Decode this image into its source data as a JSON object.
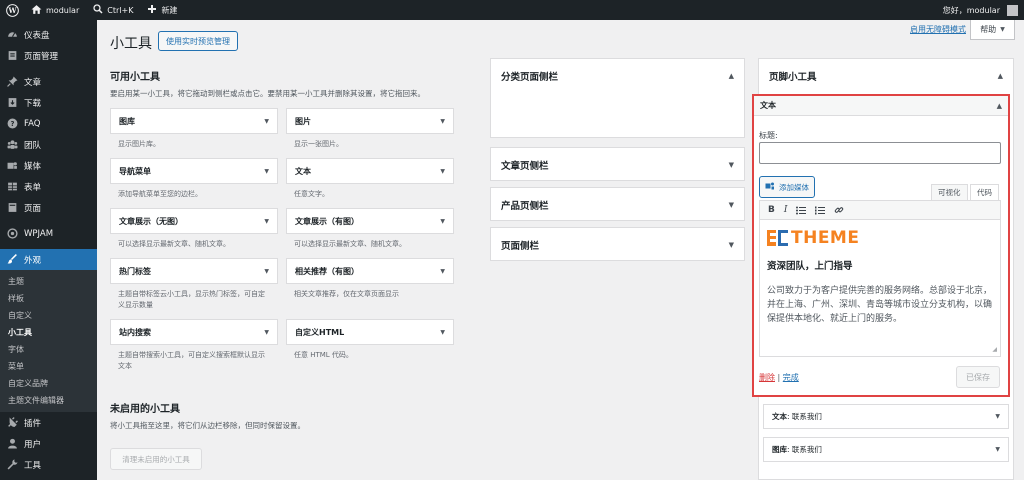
{
  "adminbar": {
    "site_name": "modular",
    "search_shortcut": "Ctrl+K",
    "new_label": "新建",
    "greeting": "您好，modular"
  },
  "sidebar": {
    "items": [
      {
        "label": "仪表盘",
        "icon": "dashboard-icon"
      },
      {
        "label": "页面管理",
        "icon": "pages-icon"
      },
      {
        "label": "文章",
        "icon": "pin-icon"
      },
      {
        "label": "下载",
        "icon": "download-icon"
      },
      {
        "label": "FAQ",
        "icon": "help-icon"
      },
      {
        "label": "团队",
        "icon": "group-icon"
      },
      {
        "label": "媒体",
        "icon": "media-icon"
      },
      {
        "label": "表单",
        "icon": "table-icon"
      },
      {
        "label": "页面",
        "icon": "page-icon"
      },
      {
        "label": "WPJAM",
        "icon": "wpjam-icon"
      },
      {
        "label": "外观",
        "icon": "brush-icon"
      },
      {
        "label": "插件",
        "icon": "plugin-icon"
      },
      {
        "label": "用户",
        "icon": "user-icon"
      },
      {
        "label": "工具",
        "icon": "wrench-icon"
      }
    ],
    "submenu": [
      "主题",
      "样板",
      "自定义",
      "小工具",
      "字体",
      "菜单",
      "自定义品牌",
      "主题文件编辑器"
    ]
  },
  "header": {
    "title": "小工具",
    "preview_button": "使用实时预览管理",
    "a11y_link": "启用无障碍模式",
    "help_tab": "帮助"
  },
  "available": {
    "title": "可用小工具",
    "description": "要启用某一小工具，将它拖动到侧栏或点击它。要禁用某一小工具并删除其设置，将它拖回来。",
    "widgets": [
      {
        "name": "图库",
        "desc": "显示图片库。"
      },
      {
        "name": "图片",
        "desc": "显示一张图片。"
      },
      {
        "name": "导航菜单",
        "desc": "添加导航菜单至您的边栏。"
      },
      {
        "name": "文本",
        "desc": "任意文字。"
      },
      {
        "name": "文章展示（无图）",
        "desc": "可以选择显示最新文章、随机文章。"
      },
      {
        "name": "文章展示（有图）",
        "desc": "可以选择显示最新文章、随机文章。"
      },
      {
        "name": "热门标签",
        "desc": "主题自带标签云小工具，显示热门标签，可自定义显示数量"
      },
      {
        "name": "相关推荐（有图）",
        "desc": "相关文章推荐，仅在文章页面显示"
      },
      {
        "name": "站内搜索",
        "desc": "主题自带搜索小工具，可自定义搜索框默认显示文本"
      },
      {
        "name": "自定义HTML",
        "desc": "任意 HTML 代码。"
      }
    ]
  },
  "inactive": {
    "title": "未启用的小工具",
    "description": "将小工具拖至这里，将它们从边栏移除，但同时保留设置。",
    "clear_button": "清理未启用的小工具"
  },
  "sidebars": {
    "category": "分类页面侧栏",
    "article": "文章页侧栏",
    "product": "产品页侧栏",
    "page": "页面侧栏"
  },
  "footer_sidebar": {
    "title": "页脚小工具",
    "text_widget": {
      "header": "文本",
      "title_label": "标题:",
      "title_value": "",
      "add_media": "添加媒体",
      "tab_visual": "可视化",
      "tab_code": "代码",
      "logo_text": "THEME",
      "heading": "资深团队，上门指导",
      "paragraph": "公司致力于为客户提供完善的服务网络。总部设于北京，并在上海、广州、深圳、青岛等城市设立分支机构，以确保提供本地化、就近上门的服务。",
      "delete_link": "删除",
      "separator": "|",
      "done_link": "完成",
      "save_button": "已保存"
    },
    "other_widgets": [
      {
        "type": "文本",
        "title": ": 联系我们"
      },
      {
        "type": "图库",
        "title": ": 联系我们"
      }
    ]
  },
  "colors": {
    "admin_dark": "#1d2327",
    "accent_blue": "#2271b1",
    "highlight_red": "#e04343",
    "logo_orange": "#f58220",
    "logo_blue": "#2b6cb0"
  }
}
